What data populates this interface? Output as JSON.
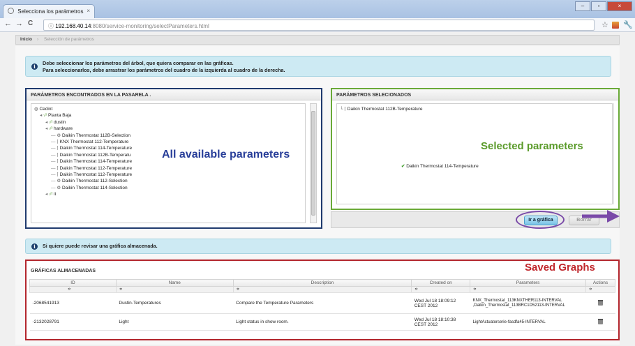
{
  "browser": {
    "tab_title": "Selecciona los parámetros",
    "tab_close": "×",
    "back": "←",
    "forward": "→",
    "reload": "C",
    "url_host": "192.168.40.14",
    "url_path": ":8080/service-monitoring/selectParameters.html",
    "star": "☆",
    "minimize": "–",
    "maximize": "▫",
    "close": "×"
  },
  "breadcrumb": {
    "home": "Inicio",
    "current": "Selección de parámetros"
  },
  "info_top": {
    "line1": "Debe seleccionar los parámetros del árbol, que quiera comparar en las gráficas.",
    "line2": "Para seleccionarlos, debe arrastrar los parámetros del cuadro de la izquierda al cuadro de la derecha."
  },
  "left_panel": {
    "title": "PARÁMETROS ENCONTRADOS EN LA PASARELA .",
    "tree": [
      {
        "label": "Cedint",
        "level": 0,
        "icon": "globe"
      },
      {
        "label": "Planta Baja",
        "level": 1,
        "icon": "folder"
      },
      {
        "label": "dustin",
        "level": 2,
        "icon": "folder"
      },
      {
        "label": "hardware",
        "level": 2,
        "icon": "folder"
      },
      {
        "label": "Daikin Thermostat 112B-Selection",
        "level": 3,
        "icon": "gear"
      },
      {
        "label": "KNX Thermostat 112-Temperature",
        "level": 3,
        "icon": "leaf"
      },
      {
        "label": "Daikin Thermostat 114-Temperature",
        "level": 3,
        "icon": "leaf"
      },
      {
        "label": "Daikin Thermostat 112B-Temperatu",
        "level": 3,
        "icon": "leaf"
      },
      {
        "label": "Daikin Thermostat 114-Temperature",
        "level": 3,
        "icon": "leaf"
      },
      {
        "label": "Daikin Thermostat 112-Temperature",
        "level": 3,
        "icon": "leaf"
      },
      {
        "label": "Daikin Thermostat 112-Temperature",
        "level": 3,
        "icon": "leaf"
      },
      {
        "label": "Daikin Thermostat 112-Selection",
        "level": 3,
        "icon": "gear"
      },
      {
        "label": "Daikin Thermostat 114-Selection",
        "level": 3,
        "icon": "gear"
      },
      {
        "label": "it",
        "level": 2,
        "icon": "folder"
      }
    ],
    "annotation": "All available parameters"
  },
  "right_panel": {
    "title": "PARÁMETROS SELECIONADOS",
    "selected_item": "Daikin Thermostat 112B-Temperature",
    "drop_item": "Daikin Thermostat 114-Temperature",
    "annotation": "Selected parameters",
    "go_button": "Ir a gráfica",
    "second_button": "Borrar"
  },
  "info_saved": {
    "text": "Si quiere puede revisar una gráfica almacenada."
  },
  "saved_graphs": {
    "title": "GRÁFICAS ALMACENADAS",
    "annotation": "Saved Graphs",
    "columns": [
      "ID",
      "Name",
      "Description",
      "Created on",
      "Parameters",
      "Actions"
    ],
    "filter_hint": "≎",
    "rows": [
      {
        "id": "-2068541913",
        "name": "Dustin-Temperatures",
        "description": "Compare the Temperature Parameters",
        "created": "Wed Jul 18 18:09:12 CEST 2012",
        "parameters": "KNX_Thermostat_113KNXTHER113-INTERVAL ,Daikin_Thermostat_113BRC1D52113-INTERVAL"
      },
      {
        "id": "-2132028791",
        "name": "Light",
        "description": "Light status in show room.",
        "created": "Wed Jul 18 18:10:38 CEST 2012",
        "parameters": "LightActuatorserie-fasdfa45-INTERVAL"
      }
    ]
  },
  "colors": {
    "left_annotation": "#283e99",
    "right_annotation": "#5b9b2b",
    "saved_annotation": "#c0262b",
    "left_frame": "#1f3a6e",
    "right_frame": "#6aaa38",
    "saved_frame": "#b3262d",
    "highlight_circle": "#7a4aa8",
    "arrow": "#7a4aa8"
  }
}
